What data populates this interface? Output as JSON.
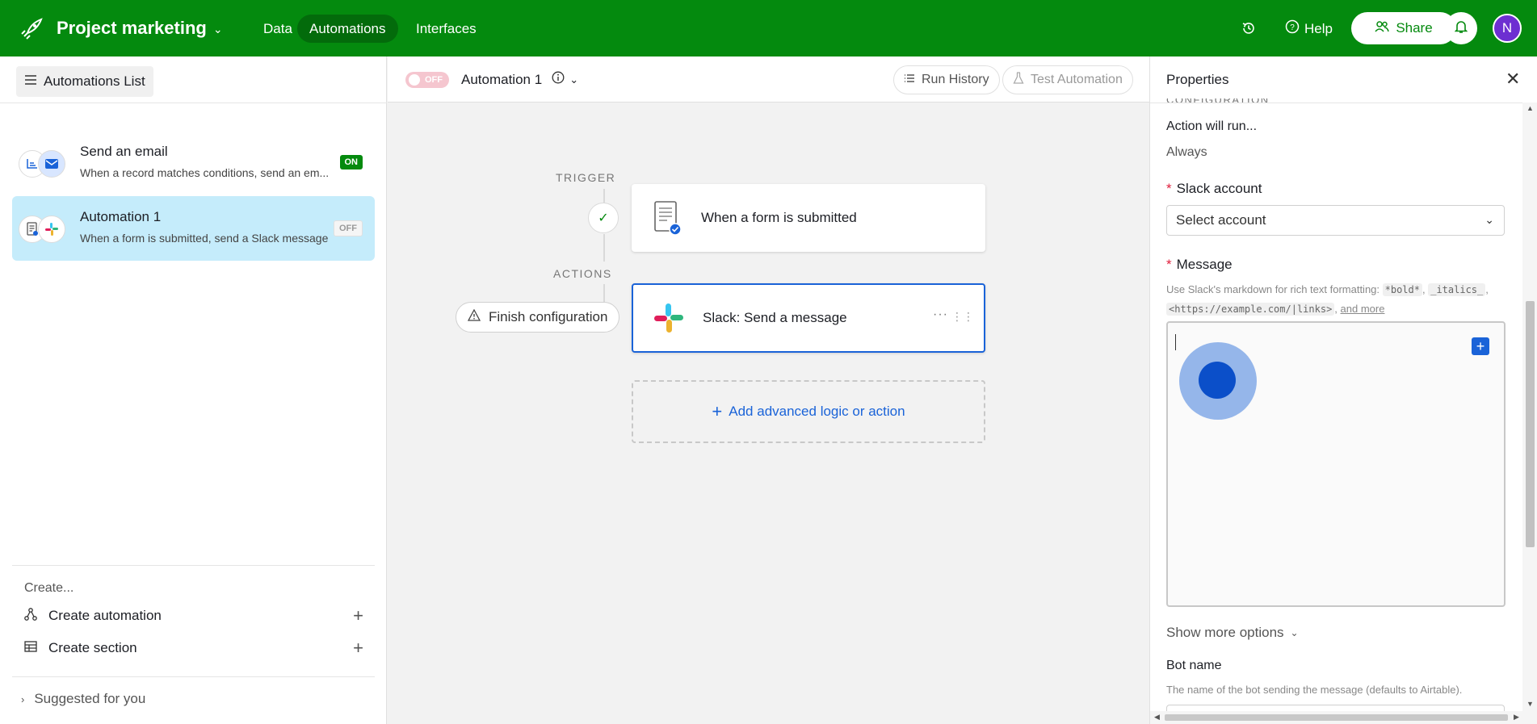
{
  "app": {
    "project_title": "Project marketing",
    "tabs": [
      {
        "label": "Data"
      },
      {
        "label": "Automations"
      },
      {
        "label": "Interfaces"
      }
    ],
    "help_label": "Help",
    "share_label": "Share",
    "avatar_initial": "N",
    "brand_color": "#048a0e"
  },
  "sidebar": {
    "list_button_label": "Automations List",
    "automations": [
      {
        "title": "Send an email",
        "description": "When a record matches conditions, send an em...",
        "status": "ON"
      },
      {
        "title": "Automation 1",
        "description": "When a form is submitted, send a Slack message",
        "status": "OFF"
      }
    ],
    "create_label": "Create...",
    "create_automation_label": "Create automation",
    "create_section_label": "Create section",
    "suggested_label": "Suggested for you"
  },
  "editor": {
    "toggle_label": "OFF",
    "automation_name": "Automation 1",
    "run_history_label": "Run History",
    "test_automation_label": "Test Automation",
    "trigger_label": "TRIGGER",
    "actions_label": "ACTIONS",
    "trigger_card_title": "When a form is submitted",
    "action_card_title": "Slack: Send a message",
    "finish_config_label": "Finish configuration",
    "add_logic_label": "Add advanced logic or action"
  },
  "properties": {
    "title": "Properties",
    "section_cut_label": "CONFIGURATION",
    "action_runs_label": "Action will run...",
    "action_runs_value": "Always",
    "slack_account_label": "Slack account",
    "slack_account_placeholder": "Select account",
    "message_label": "Message",
    "message_hint_prefix": "Use Slack's markdown for rich text formatting: ",
    "hint_bold": "*bold*",
    "hint_italics": "_italics_",
    "hint_links": "<https://example.com/|links>",
    "hint_more": "and more",
    "show_more_label": "Show more options",
    "bot_name_label": "Bot name",
    "bot_name_hint": "The name of the bot sending the message (defaults to Airtable)."
  }
}
